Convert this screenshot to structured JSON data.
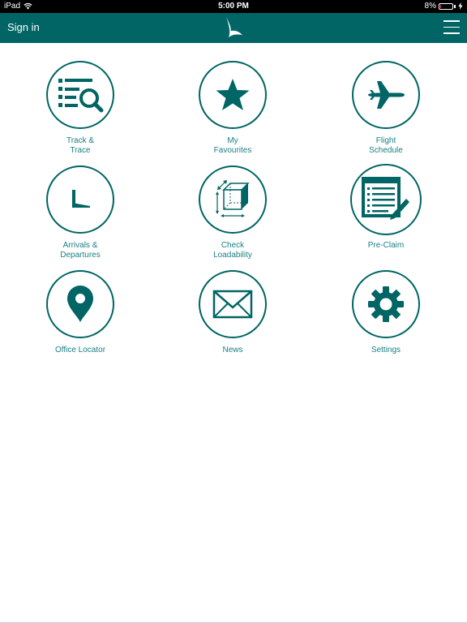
{
  "status_bar": {
    "device": "iPad",
    "time": "5:00 PM",
    "battery": "8%",
    "battery_level": 0.08
  },
  "header": {
    "sign_in_label": "Sign in",
    "logo_icon": "brushwing-logo-icon",
    "menu_icon": "hamburger-menu-icon"
  },
  "colors": {
    "brand": "#006564",
    "label": "#1a7f82"
  },
  "tiles": [
    {
      "label": "Track &\nTrace",
      "icon": "track-trace-icon"
    },
    {
      "label": "My\nFavourites",
      "icon": "star-icon"
    },
    {
      "label": "Flight\nSchedule",
      "icon": "airplane-icon"
    },
    {
      "label": "Arrivals &\nDepartures",
      "icon": "clock-icon"
    },
    {
      "label": "Check\nLoadability",
      "icon": "cube-dimensions-icon"
    },
    {
      "label": "Pre-Claim",
      "icon": "form-pencil-icon"
    },
    {
      "label": "Office Locator",
      "icon": "location-pin-icon"
    },
    {
      "label": "News",
      "icon": "envelope-icon"
    },
    {
      "label": "Settings",
      "icon": "gear-icon"
    }
  ]
}
